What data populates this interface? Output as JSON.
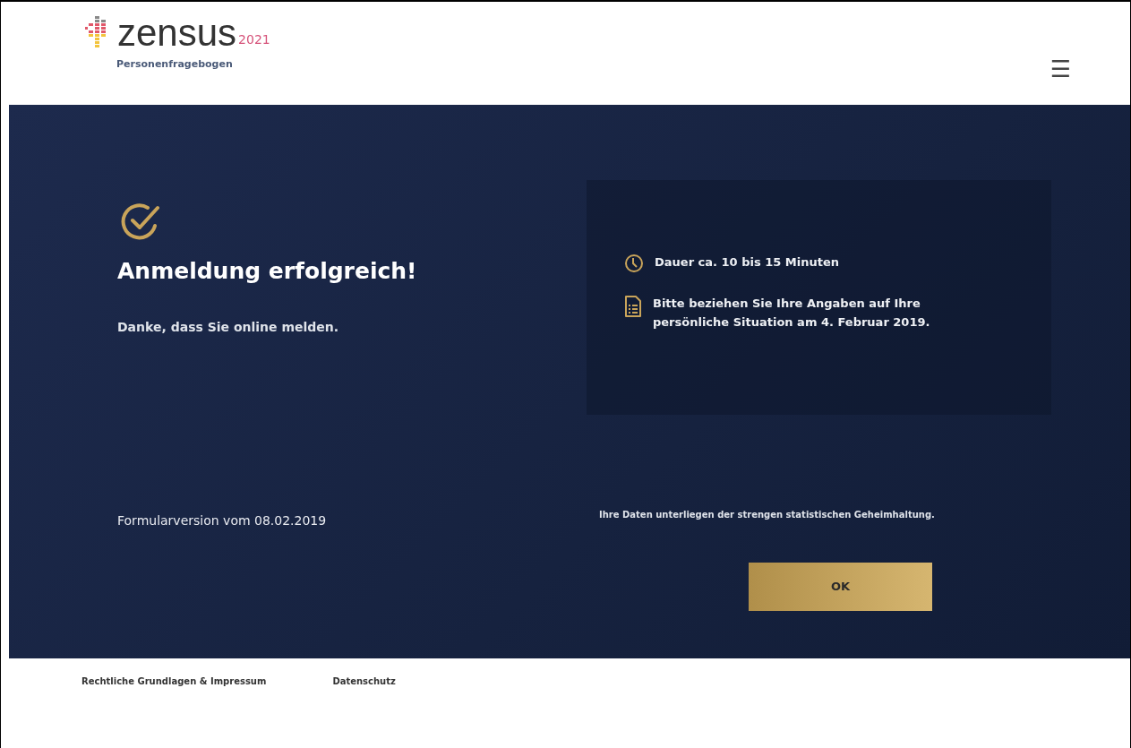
{
  "header": {
    "logo_word": "zensus",
    "logo_year": "2021",
    "subtitle": "Personenfragebogen",
    "menu_icon": "☰"
  },
  "hero": {
    "title": "Anmeldung erfolgreich!",
    "message": "Danke, dass Sie online melden.",
    "form_version": "Formularversion vom 08.02.2019"
  },
  "info": [
    {
      "kind": "clock",
      "text": "Dauer ca. 10 bis 15 Minuten"
    },
    {
      "kind": "document",
      "text": "Bitte beziehen Sie Ihre Angaben auf Ihre persönliche Situation am 4. Februar 2019."
    }
  ],
  "privacy_note": "Ihre Daten unterliegen der strengen statistischen Geheimhaltung.",
  "ok_button": "OK",
  "footer_links": [
    "Rechtliche Grundlagen & Impressum",
    "Datenschutz"
  ]
}
